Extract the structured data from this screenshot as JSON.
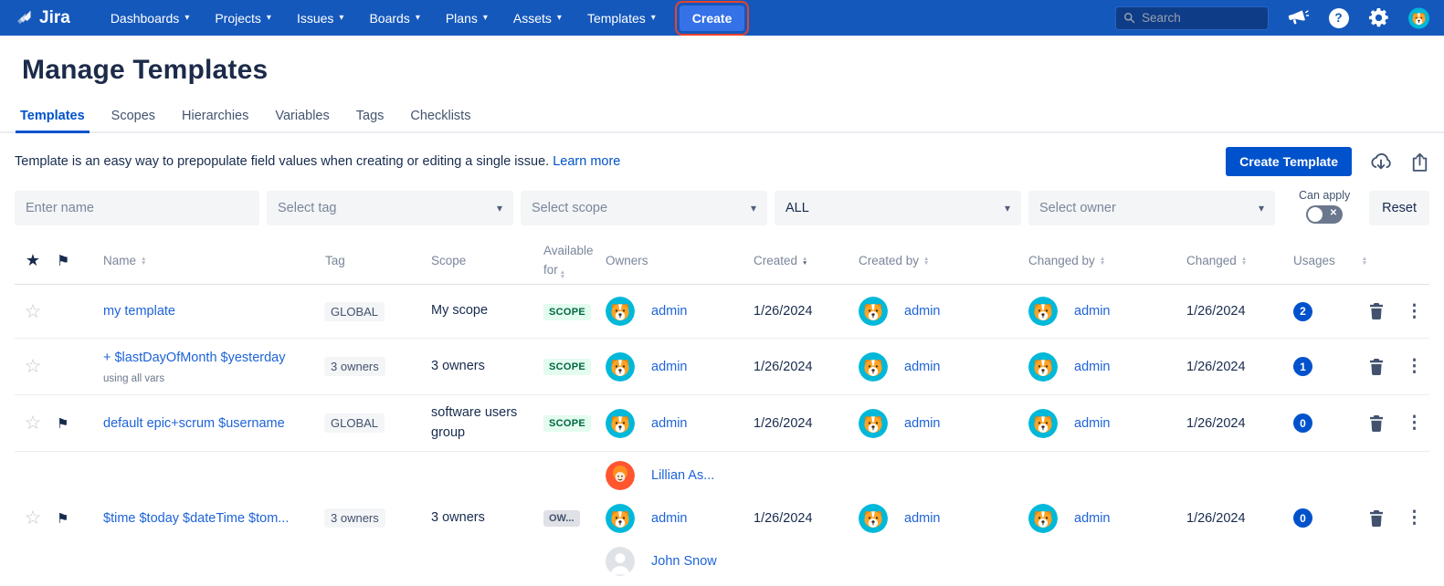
{
  "nav": {
    "brand": "Jira",
    "items": [
      {
        "label": "Dashboards"
      },
      {
        "label": "Projects"
      },
      {
        "label": "Issues"
      },
      {
        "label": "Boards"
      },
      {
        "label": "Plans"
      },
      {
        "label": "Assets"
      },
      {
        "label": "Templates"
      }
    ],
    "create_label": "Create",
    "search_placeholder": "Search"
  },
  "page": {
    "title": "Manage Templates",
    "tabs": [
      {
        "label": "Templates",
        "active": true
      },
      {
        "label": "Scopes"
      },
      {
        "label": "Hierarchies"
      },
      {
        "label": "Variables"
      },
      {
        "label": "Tags"
      },
      {
        "label": "Checklists"
      }
    ],
    "description": "Template is an easy way to prepopulate field values when creating or editing a single issue.",
    "learn_more_label": "Learn more",
    "create_template_label": "Create Template"
  },
  "filters": {
    "name_placeholder": "Enter name",
    "tag_placeholder": "Select tag",
    "scope_placeholder": "Select scope",
    "project_value": "ALL",
    "owner_placeholder": "Select owner",
    "can_apply_label": "Can apply",
    "can_apply_state": "off",
    "reset_label": "Reset"
  },
  "table": {
    "headers": {
      "name": "Name",
      "tag": "Tag",
      "scope": "Scope",
      "available_for": "Available for",
      "owners": "Owners",
      "created": "Created",
      "created_by": "Created by",
      "changed_by": "Changed by",
      "changed": "Changed",
      "usages": "Usages"
    },
    "sort_active": "Created (descending)",
    "rows": [
      {
        "starred": false,
        "flagged": false,
        "name": "my template",
        "subtitle": "",
        "tag": "GLOBAL",
        "scope": "My scope",
        "available_for": "SCOPE",
        "owners": [
          {
            "name": "admin",
            "avatar": "dog"
          }
        ],
        "created": "1/26/2024",
        "created_by": "admin",
        "changed_by": "admin",
        "changed": "1/26/2024",
        "usages": "2"
      },
      {
        "starred": false,
        "flagged": false,
        "name": "+ $lastDayOfMonth $yesterday",
        "subtitle": "using all vars",
        "tag": "3 owners",
        "scope": "3 owners",
        "available_for": "SCOPE",
        "owners": [
          {
            "name": "admin",
            "avatar": "dog"
          }
        ],
        "created": "1/26/2024",
        "created_by": "admin",
        "changed_by": "admin",
        "changed": "1/26/2024",
        "usages": "1"
      },
      {
        "starred": false,
        "flagged": true,
        "name": "default epic+scrum $username",
        "subtitle": "",
        "tag": "GLOBAL",
        "scope": "software users group",
        "available_for": "SCOPE",
        "owners": [
          {
            "name": "admin",
            "avatar": "dog"
          }
        ],
        "created": "1/26/2024",
        "created_by": "admin",
        "changed_by": "admin",
        "changed": "1/26/2024",
        "usages": "0"
      },
      {
        "starred": false,
        "flagged": true,
        "name": "$time $today $dateTime $tom...",
        "subtitle": "",
        "tag": "3 owners",
        "scope": "3 owners",
        "available_for": "OW...",
        "owners": [
          {
            "name": "Lillian As...",
            "avatar": "orange-person"
          },
          {
            "name": "admin",
            "avatar": "dog"
          },
          {
            "name": "John Snow",
            "avatar": "gray-person"
          }
        ],
        "created": "1/26/2024",
        "created_by": "admin",
        "changed_by": "admin",
        "changed": "1/26/2024",
        "usages": "0"
      }
    ]
  },
  "icons": {
    "star_filled": "★",
    "star_outline": "☆",
    "flag": "⚑",
    "chevron_down": "▾",
    "kebab": "⋮",
    "close": "✕",
    "question": "?",
    "sort_up": "▲",
    "sort_down": "▼"
  },
  "colors": {
    "nav_blue": "#1558BC",
    "create_button_blue": "#3572E8",
    "highlight_red": "#E8432C",
    "link_blue": "#0052CC",
    "primary_button_blue": "#0052CC",
    "scope_badge_bg": "#E3FCEF",
    "scope_badge_text": "#006644",
    "gray_badge_bg": "#F4F5F7",
    "owner_badge_bg": "#DFE1E6",
    "usage_badge_bg": "#0052CC",
    "avatar_teal": "#00B8D9",
    "avatar_orange": "#FF5630",
    "toggle_off_bg": "#6B778C"
  }
}
